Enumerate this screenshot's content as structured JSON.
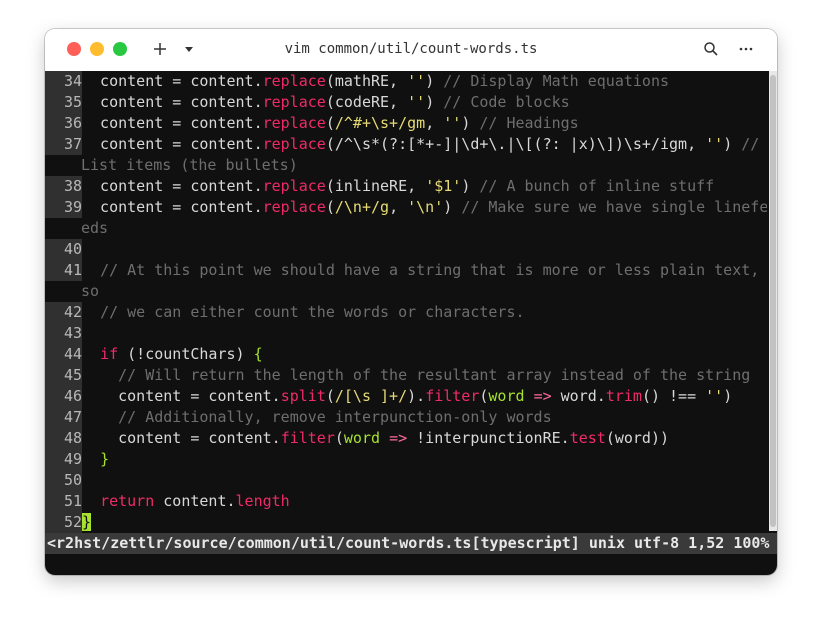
{
  "window": {
    "title": "vim common/util/count-words.ts",
    "new_tab_label": "+",
    "dropdown_label": "▾",
    "search_label": "⌕",
    "more_label": "⋯"
  },
  "status_line": "<r2hst/zettlr/source/common/util/count-words.ts[typescript] unix utf-8 1,52 100%",
  "code_lines": [
    {
      "n": "34",
      "wrap": false,
      "text": "  content = content.replace(mathRE, '') // Display Math equations"
    },
    {
      "n": "35",
      "wrap": false,
      "text": "  content = content.replace(codeRE, '') // Code blocks"
    },
    {
      "n": "36",
      "wrap": false,
      "text": "  content = content.replace(/^#+\\s+/gm, '') // Headings"
    },
    {
      "n": "37",
      "wrap": false,
      "text": "  content = content.replace(/^\\s*(?:[*+-]|\\d+\\.|\\[(?: |x)\\])\\s+/igm, '') //"
    },
    {
      "n": "",
      "wrap": true,
      "text": "List items (the bullets)"
    },
    {
      "n": "38",
      "wrap": false,
      "text": "  content = content.replace(inlineRE, '$1') // A bunch of inline stuff"
    },
    {
      "n": "39",
      "wrap": false,
      "text": "  content = content.replace(/\\n+/g, '\\n') // Make sure we have single linefe"
    },
    {
      "n": "",
      "wrap": true,
      "text": "eds"
    },
    {
      "n": "40",
      "wrap": false,
      "text": ""
    },
    {
      "n": "41",
      "wrap": false,
      "text": "  // At this point we should have a string that is more or less plain text,"
    },
    {
      "n": "",
      "wrap": true,
      "text": "so"
    },
    {
      "n": "42",
      "wrap": false,
      "text": "  // we can either count the words or characters."
    },
    {
      "n": "43",
      "wrap": false,
      "text": ""
    },
    {
      "n": "44",
      "wrap": false,
      "text": "  if (!countChars) {"
    },
    {
      "n": "45",
      "wrap": false,
      "text": "    // Will return the length of the resultant array instead of the string"
    },
    {
      "n": "46",
      "wrap": false,
      "text": "    content = content.split(/[\\s ]+/).filter(word => word.trim() !== '')"
    },
    {
      "n": "47",
      "wrap": false,
      "text": "    // Additionally, remove interpunction-only words"
    },
    {
      "n": "48",
      "wrap": false,
      "text": "    content = content.filter(word => !interpunctionRE.test(word))"
    },
    {
      "n": "49",
      "wrap": false,
      "text": "  }"
    },
    {
      "n": "50",
      "wrap": false,
      "text": ""
    },
    {
      "n": "51",
      "wrap": false,
      "text": "  return content.length"
    },
    {
      "n": "52",
      "wrap": false,
      "text": "}"
    }
  ],
  "colors": {
    "keyword": "#f02a68",
    "comment": "#6e6e6e",
    "string": "#e6db74",
    "param": "#a6e22e",
    "background": "#101010"
  }
}
